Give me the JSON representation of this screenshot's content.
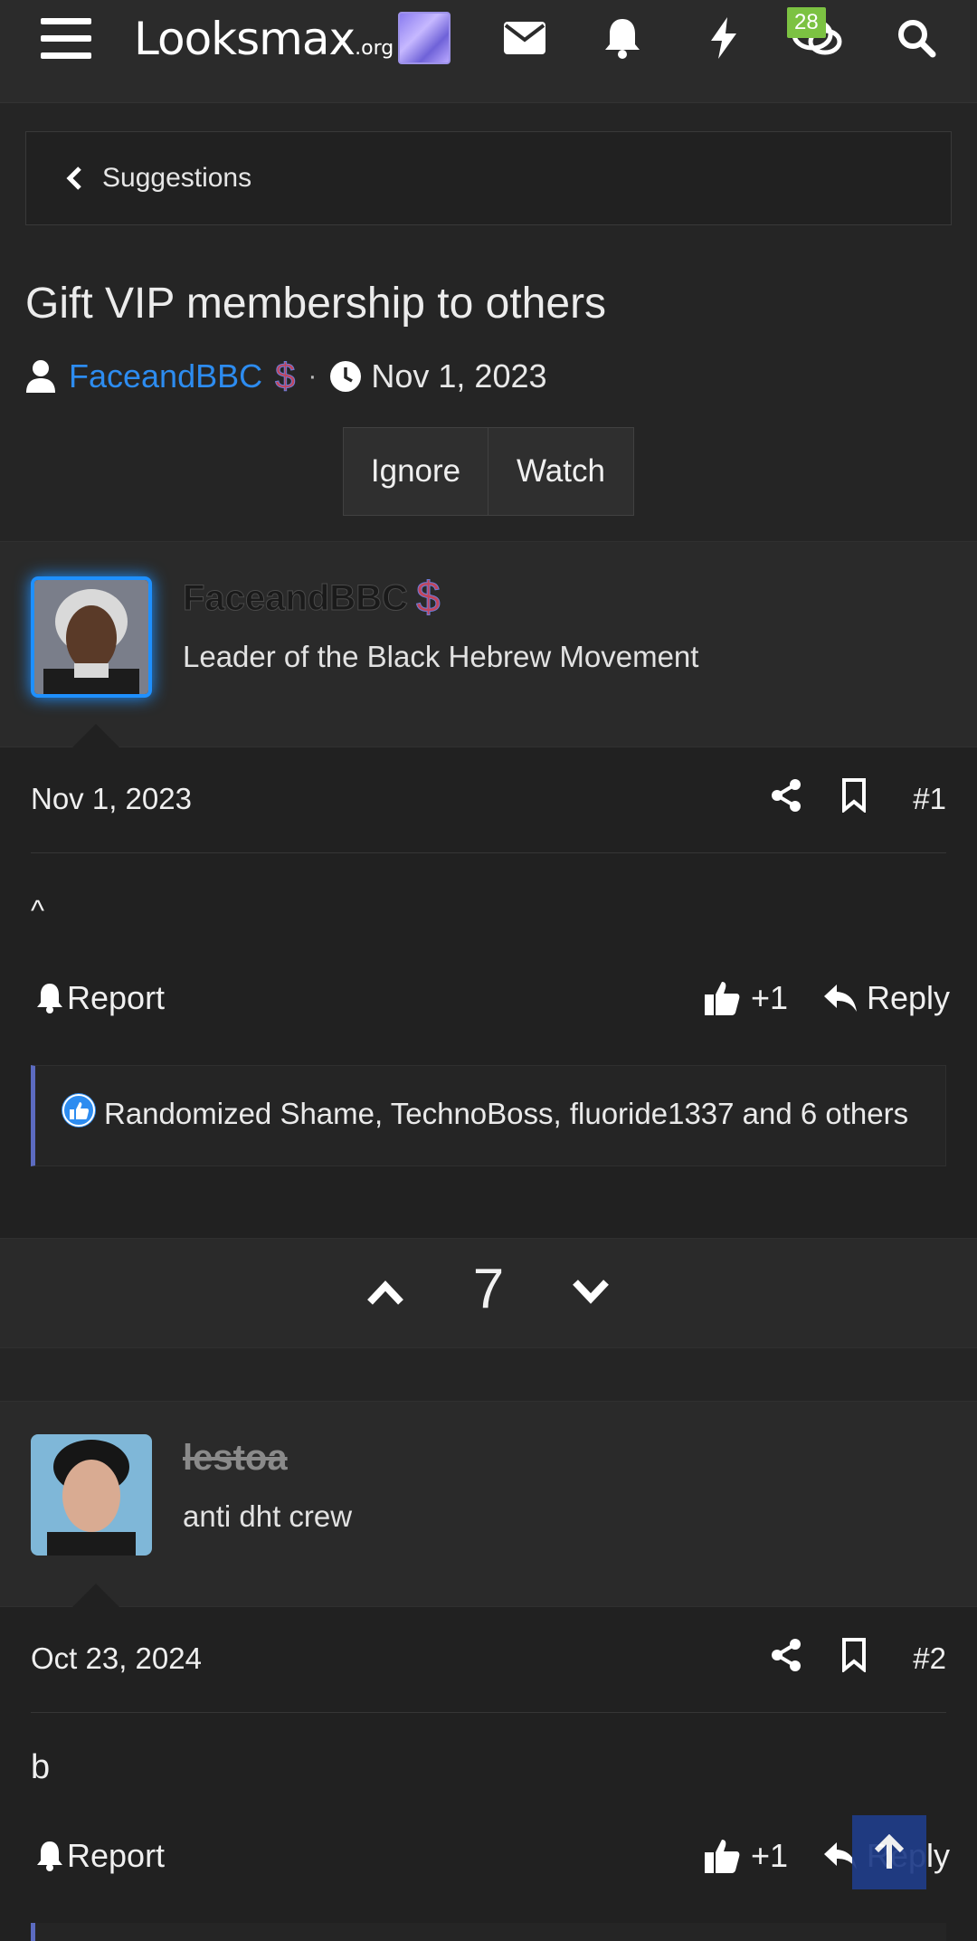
{
  "topbar": {
    "logo_main": "Looksmax",
    "logo_suffix": ".org",
    "alerts_badge": "28",
    "icons": [
      "menu-icon",
      "avatar-thumb",
      "envelope-icon",
      "bell-icon",
      "bolt-icon",
      "chat-icon",
      "search-icon"
    ]
  },
  "breadcrumb": {
    "label": "Suggestions"
  },
  "thread": {
    "title": "Gift VIP membership to others",
    "author": "FaceandBBC",
    "date": "Nov 1, 2023",
    "ignore_label": "Ignore",
    "watch_label": "Watch"
  },
  "posts": [
    {
      "username": "FaceandBBC",
      "user_title": "Leader of the Black Hebrew Movement",
      "date": "Nov 1, 2023",
      "number": "#1",
      "body": "^",
      "report_label": "Report",
      "like_label": "+1",
      "reply_label": "Reply",
      "reactions_text": "Randomized Shame, TechnoBoss, fluoride1337 and 6 others"
    },
    {
      "username": "lestoa",
      "user_title": "anti dht crew",
      "date": "Oct 23, 2024",
      "number": "#2",
      "body": "b",
      "report_label": "Report",
      "like_label": "+1",
      "reply_label": "Reply"
    }
  ],
  "votes": {
    "count": "7"
  },
  "colors": {
    "accent_blue": "#2d8cf0",
    "badge_green": "#7cc242",
    "reaction_border": "#5c6bc0",
    "scroll_button": "#1f3c88"
  }
}
